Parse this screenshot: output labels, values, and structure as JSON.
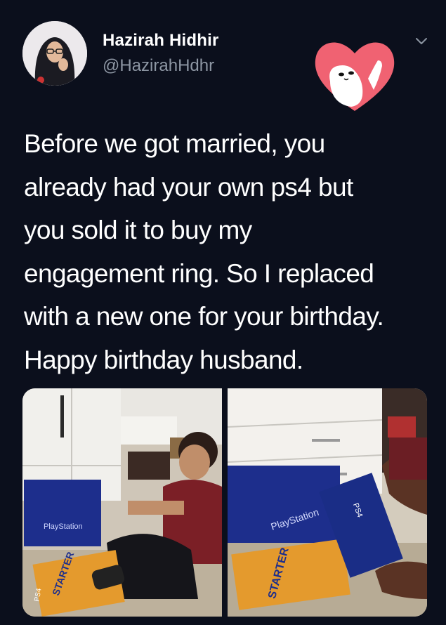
{
  "tweet": {
    "author": {
      "display_name": "Hazirah Hidhir",
      "handle": "@HazirahHdhr",
      "avatar_icon": "profile-photo"
    },
    "menu_icon": "chevron-down-icon",
    "sticker_icon": "heart-sticker-icon",
    "text": "Before we got married, you\nalready had your own ps4 but\nyou sold it to buy my\nengagement ring. So I replaced\nwith a new one for your birthday.\nHappy birthday husband.",
    "media": [
      {
        "description_icon": "photo-man-opening-gift",
        "bag_label": "PlayStation",
        "box_label": "STARTER",
        "box_brand": "PS4"
      },
      {
        "description_icon": "photo-ps4-box",
        "bag_label": "PlayStation",
        "box_label": "STARTER",
        "box_brand": "PS4"
      }
    ],
    "colors": {
      "background": "#0b0f1c",
      "text": "#ffffff",
      "handle": "#8d96a3",
      "heart": "#f06272"
    }
  }
}
